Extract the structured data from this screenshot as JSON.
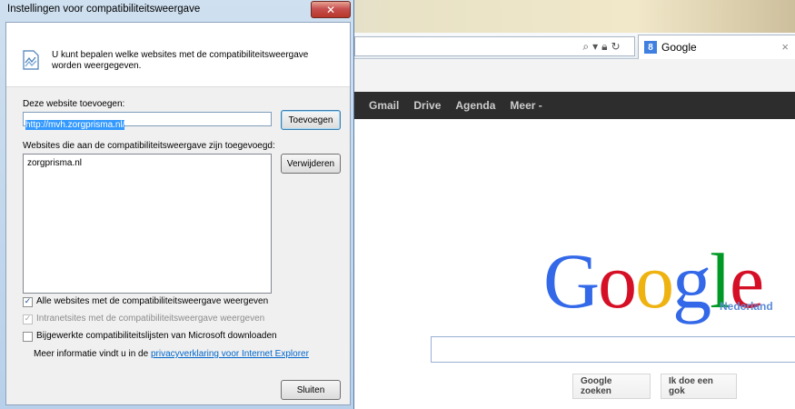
{
  "dialog": {
    "title": "Instellingen voor compatibiliteitsweergave",
    "close_glyph": "✕",
    "info_text": "U kunt bepalen welke websites met de compatibiliteitsweergave worden weergegeven.",
    "add_label": "Deze website toevoegen:",
    "url_value": "http://mvh.zorgprisma.nl/",
    "add_button": "Toevoegen",
    "list_label": "Websites die aan de compatibiliteitsweergave zijn toegevoegd:",
    "sites": [
      "zorgprisma.nl"
    ],
    "remove_button": "Verwijderen",
    "checkboxes": [
      {
        "label": "Alle websites met de compatibiliteitsweergave weergeven",
        "checked": true,
        "enabled": true
      },
      {
        "label": "Intranetsites met de compatibiliteitsweergave weergeven",
        "checked": true,
        "enabled": false
      },
      {
        "label": "Bijgewerkte compatibiliteitslijsten van Microsoft downloaden",
        "checked": false,
        "enabled": true
      }
    ],
    "more_info_prefix": "Meer informatie vindt u in de ",
    "more_info_link": "privacyverklaring voor Internet Explorer",
    "close_button": "Sluiten"
  },
  "browser": {
    "tab_title": "Google",
    "tab_favicon": "8",
    "tab_close": "×",
    "address_icons": [
      "search-icon",
      "dropdown-icon",
      "lock-icon",
      "refresh-icon"
    ],
    "google_bar": [
      "Gmail",
      "Drive",
      "Agenda",
      "Meer -"
    ],
    "logo_letters": [
      {
        "ch": "G",
        "color": "#3369e8"
      },
      {
        "ch": "o",
        "color": "#d50f25"
      },
      {
        "ch": "o",
        "color": "#eeb211"
      },
      {
        "ch": "g",
        "color": "#3369e8"
      },
      {
        "ch": "l",
        "color": "#009925"
      },
      {
        "ch": "e",
        "color": "#d50f25"
      }
    ],
    "logo_sub": "Nederland",
    "search_button": "Google zoeken",
    "lucky_button": "Ik doe een gok"
  }
}
